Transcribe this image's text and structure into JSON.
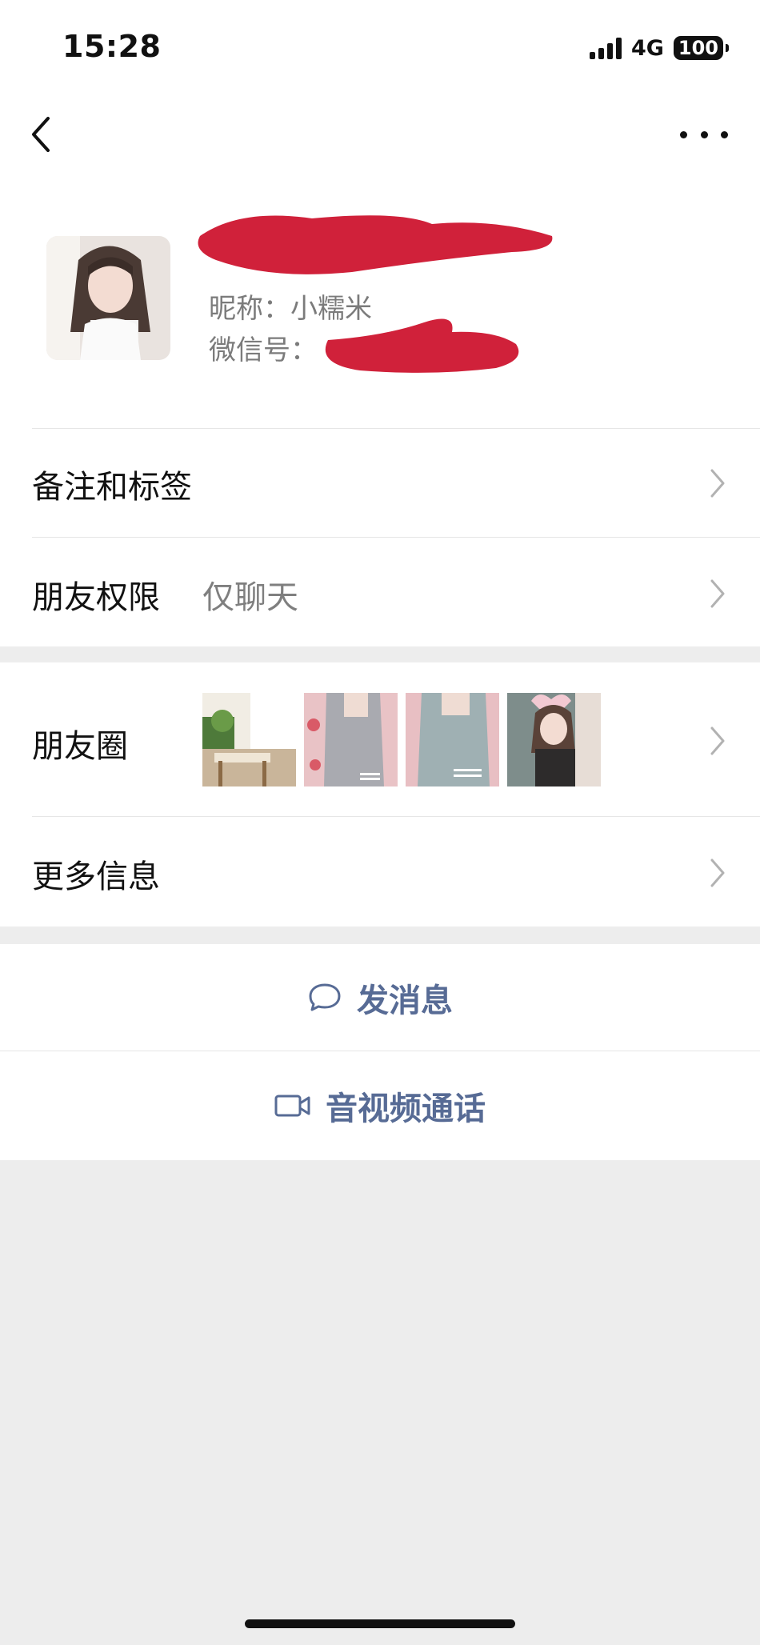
{
  "status_bar": {
    "time": "15:28",
    "network": "4G",
    "battery": "100"
  },
  "profile": {
    "nickname": "昵称：小糯米",
    "wechat_id_label": "微信号：",
    "redaction_color": "#d0213a"
  },
  "rows": {
    "remarks_tags": "备注和标签",
    "friend_permissions": "朋友权限",
    "friend_permissions_value": "仅聊天",
    "moments": "朋友圈",
    "more_info": "更多信息"
  },
  "actions": {
    "send_message": "发消息",
    "video_call": "音视频通话"
  },
  "colors": {
    "link_blue": "#576b95",
    "background": "#ededed"
  }
}
